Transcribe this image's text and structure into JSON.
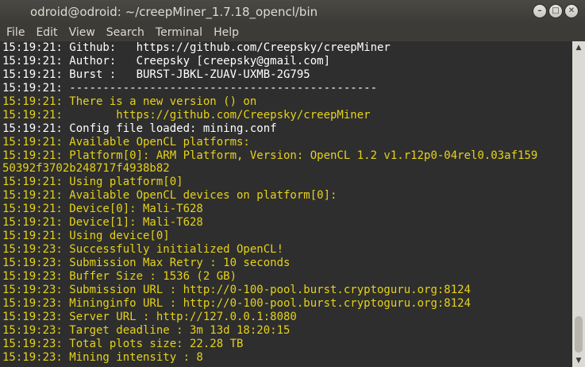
{
  "window": {
    "title": "odroid@odroid: ~/creepMiner_1.7.18_opencl/bin",
    "buttons": {
      "minimize": "–",
      "maximize": "□",
      "close": "✕"
    }
  },
  "menu": [
    "File",
    "Edit",
    "View",
    "Search",
    "Terminal",
    "Help"
  ],
  "terminal": {
    "lines": [
      {
        "text": "15:19:21: Github:   https://github.com/Creepsky/creepMiner",
        "color": "white"
      },
      {
        "text": "15:19:21: Author:   Creepsky [creepsky@gmail.com]",
        "color": "white"
      },
      {
        "text": "15:19:21: Burst :   BURST-JBKL-ZUAV-UXMB-2G795",
        "color": "white"
      },
      {
        "text": "15:19:21: ----------------------------------------------",
        "color": "white"
      },
      {
        "text": "15:19:21: There is a new version () on",
        "color": "yellow"
      },
      {
        "text": "15:19:21:        https://github.com/Creepsky/creepMiner",
        "color": "yellow"
      },
      {
        "text": "15:19:21: Config file loaded: mining.conf",
        "color": "white"
      },
      {
        "text": "15:19:21: Available OpenCL platforms:",
        "color": "yellow"
      },
      {
        "text": "15:19:21: Platform[0]: ARM Platform, Version: OpenCL 1.2 v1.r12p0-04rel0.03af159",
        "color": "yellow"
      },
      {
        "text": "50392f3702b248717f4938b82",
        "color": "yellow"
      },
      {
        "text": "15:19:21: Using platform[0]",
        "color": "yellow"
      },
      {
        "text": "15:19:21: Available OpenCL devices on platform[0]:",
        "color": "yellow"
      },
      {
        "text": "15:19:21: Device[0]: Mali-T628",
        "color": "yellow"
      },
      {
        "text": "15:19:21: Device[1]: Mali-T628",
        "color": "yellow"
      },
      {
        "text": "15:19:21: Using device[0]",
        "color": "yellow"
      },
      {
        "text": "15:19:23: Successfully initialized OpenCL!",
        "color": "yellow"
      },
      {
        "text": "15:19:23: Submission Max Retry : 10 seconds",
        "color": "yellow"
      },
      {
        "text": "15:19:23: Buffer Size : 1536 (2 GB)",
        "color": "yellow"
      },
      {
        "text": "15:19:23: Submission URL : http://0-100-pool.burst.cryptoguru.org:8124",
        "color": "yellow"
      },
      {
        "text": "15:19:23: Mininginfo URL : http://0-100-pool.burst.cryptoguru.org:8124",
        "color": "yellow"
      },
      {
        "text": "15:19:23: Server URL : http://127.0.0.1:8080",
        "color": "yellow"
      },
      {
        "text": "15:19:23: Target deadline : 3m 13d 18:20:15",
        "color": "yellow"
      },
      {
        "text": "15:19:23: Total plots size: 22.28 TB",
        "color": "yellow"
      },
      {
        "text": "15:19:23: Mining intensity : 8",
        "color": "yellow"
      }
    ]
  },
  "scrollbar": {
    "up_arrow": "▲",
    "down_arrow": "▼"
  }
}
